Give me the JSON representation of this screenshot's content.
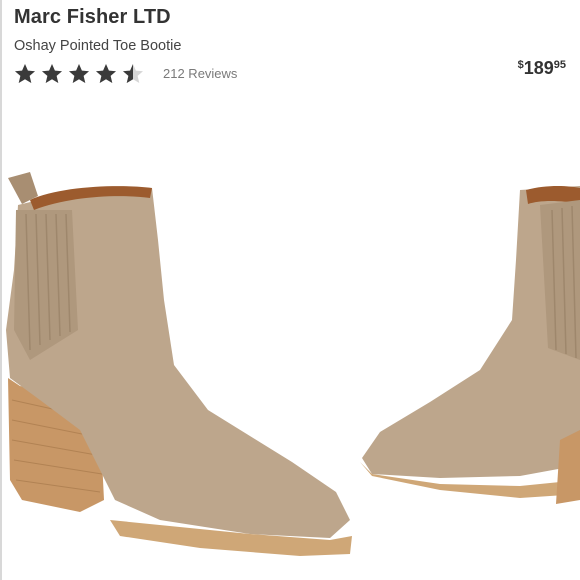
{
  "product": {
    "brand": "Marc Fisher LTD",
    "name": "Oshay Pointed Toe Bootie",
    "rating": 4.5,
    "rating_max": 5,
    "reviews_label": "212 Reviews",
    "price": {
      "currency_symbol": "$",
      "dollars": "189",
      "cents": "95"
    }
  },
  "colors": {
    "star_filled": "#3a3a3a",
    "star_empty": "#d6d6d6",
    "suede": "#bba58c",
    "heel_wood": "#c99a68",
    "lining": "#9c5b2e"
  },
  "icons": {
    "star": "star-icon"
  }
}
